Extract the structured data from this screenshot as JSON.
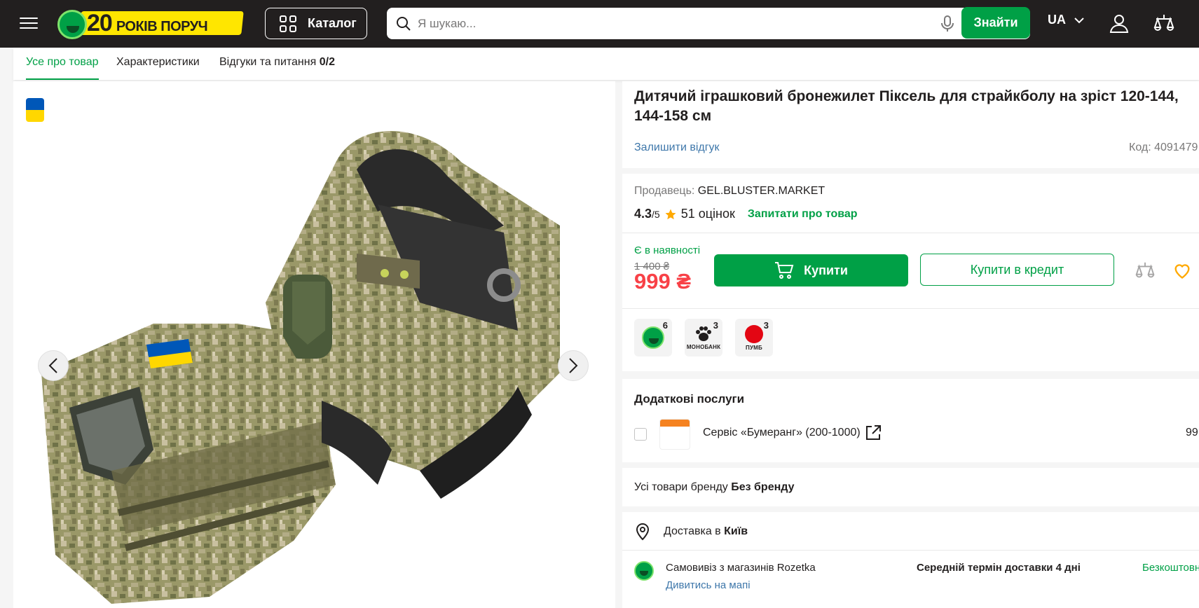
{
  "header": {
    "logo": {
      "number": "20",
      "text": "РОКІВ ПОРУЧ"
    },
    "catalog_label": "Каталог",
    "search": {
      "placeholder": "Я шукаю...",
      "value": ""
    },
    "find_label": "Знайти",
    "language": "UA",
    "icons": [
      "menu-icon",
      "grid-icon",
      "search-icon",
      "microphone-icon",
      "chevron-down-icon",
      "user-icon",
      "compare-scales-icon"
    ]
  },
  "tabs": [
    {
      "label": "Усе про товар",
      "active": true
    },
    {
      "label": "Характеристики",
      "active": false
    },
    {
      "label": "Відгуки та питання",
      "count": "0/2",
      "active": false
    }
  ],
  "product": {
    "title": "Дитячий іграшковий бронежилет Піксель для страйкболу на зріст 120-144, 144-158 см",
    "review_link": "Залишити відгук",
    "code_label": "Код:",
    "code_value": "4091479",
    "seller_label": "Продавець:",
    "seller_name": "GEL.BLUSTER.MARKET",
    "rating": {
      "value": "4.3",
      "max": "/5",
      "count_text": "51 оцінок"
    },
    "ask_label": "Запитати про товар",
    "availability": "Є в наявності",
    "old_price": "1 400 ₴",
    "price": "999 ₴",
    "buy_label": "Купити",
    "credit_label": "Купити в кредит",
    "installments": [
      {
        "name": "rozetka",
        "count": "6",
        "caption": ""
      },
      {
        "name": "monobank",
        "count": "3",
        "caption": "МОНОБАНК"
      },
      {
        "name": "pumb",
        "count": "3",
        "caption": "ПУМБ"
      }
    ]
  },
  "services": {
    "title": "Додаткові послуги",
    "item_name": "Сервіс «Бумеранг» (200-1000)",
    "item_price": "99",
    "checked": false
  },
  "brand": {
    "prefix": "Усі товари бренду",
    "name": "Без бренду"
  },
  "delivery": {
    "prefix": "Доставка в",
    "city": "Київ",
    "method": "Самовивіз з магазинів Rozetka",
    "map_link": "Дивитись на мапі",
    "term": "Середній термін доставки 4 дні",
    "cost": "Безкоштовно"
  },
  "colors": {
    "header_bg": "#221f1f",
    "accent_green": "#00a046",
    "price_red": "#f84147",
    "link_blue": "#3e77aa",
    "logo_yellow": "#ffe600"
  }
}
